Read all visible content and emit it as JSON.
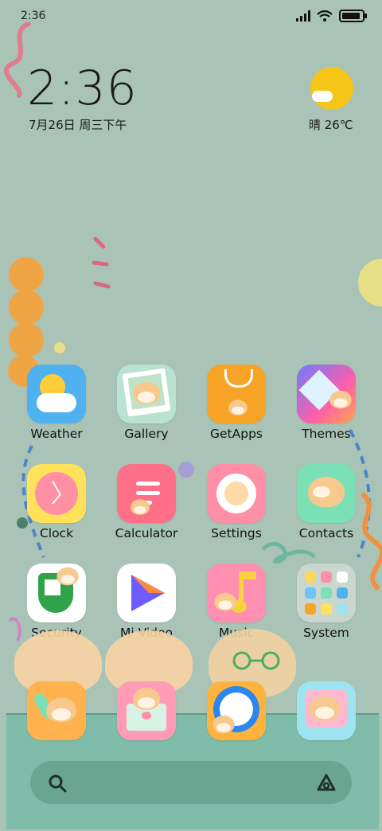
{
  "status_bar": {
    "time": "2:36"
  },
  "clock_widget": {
    "time": "2:36",
    "date": "7月26日 周三下午"
  },
  "weather_widget": {
    "text": "晴 26℃",
    "icon": "sun-cloud-icon"
  },
  "apps": [
    {
      "name": "weather",
      "label": "Weather",
      "colors": [
        "#4fb1f0",
        "#8fd0ff"
      ]
    },
    {
      "name": "gallery",
      "label": "Gallery",
      "colors": [
        "#b9e3d0",
        "#ffffff"
      ]
    },
    {
      "name": "getapps",
      "label": "GetApps",
      "colors": [
        "#f7a325",
        "#ffb84a"
      ]
    },
    {
      "name": "themes",
      "label": "Themes",
      "colors": [
        "#ff5ea8",
        "#6d7bff"
      ]
    },
    {
      "name": "clock",
      "label": "Clock",
      "colors": [
        "#ffe15a",
        "#ffd23f"
      ]
    },
    {
      "name": "calculator",
      "label": "Calculator",
      "colors": [
        "#ff6f88",
        "#ff8fa2"
      ]
    },
    {
      "name": "settings",
      "label": "Settings",
      "colors": [
        "#ff8fa6",
        "#ffffff"
      ]
    },
    {
      "name": "contacts",
      "label": "Contacts",
      "colors": [
        "#7ce0b6",
        "#a8f0cf"
      ]
    },
    {
      "name": "security",
      "label": "Security",
      "colors": [
        "#ffffff",
        "#2fa24a"
      ]
    },
    {
      "name": "mi-video",
      "label": "Mi Video",
      "colors": [
        "#ffffff",
        "#6d5cff"
      ]
    },
    {
      "name": "music",
      "label": "Music",
      "colors": [
        "#ff8fb0",
        "#f9d33f"
      ]
    },
    {
      "name": "system",
      "label": "System",
      "colors": [
        "#c9d7cf",
        "#e3ebe6"
      ]
    }
  ],
  "dock_apps": [
    {
      "name": "phone",
      "colors": [
        "#ffb24d",
        "#ffc76f"
      ]
    },
    {
      "name": "messaging",
      "colors": [
        "#ff9bb5",
        "#ffb7c9"
      ]
    },
    {
      "name": "browser",
      "colors": [
        "#ffb33c",
        "#2a86f0"
      ]
    },
    {
      "name": "camera",
      "colors": [
        "#9ee3f0",
        "#ffb7cb"
      ]
    }
  ]
}
